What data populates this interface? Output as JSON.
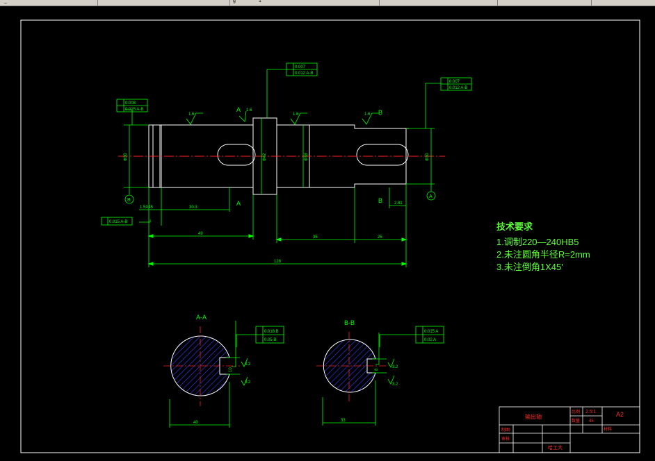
{
  "window": {
    "title_fragment": "_",
    "toolbar_fragment_1": "g",
    "toolbar_fragment_2": "1"
  },
  "colors": {
    "background": "#000000",
    "outline": "#ffffff",
    "dimension": "#00ff00",
    "centerline": "#ff0000",
    "hatch": "#3a3aff",
    "text": "#5dff3a",
    "titleblock_text": "#ff3030"
  },
  "roughness": {
    "r1": "1.6",
    "r2": "1.6",
    "r3": "1.6",
    "r4": "1.6",
    "r5": "1.6",
    "s1": "3.2",
    "s2": "3.2",
    "s3": "3.2",
    "s4": "3.2"
  },
  "datums": {
    "a": "A",
    "b": "B"
  },
  "tolerance_frames": {
    "left": {
      "row1": "0.008",
      "row2": "0.015 A-B"
    },
    "top_center": {
      "row1": "0.007",
      "row2": "0.012 A-B"
    },
    "top_right": {
      "row1": "0.007",
      "row2": "0.012 A-B"
    },
    "bottom_left": {
      "row1": "0.015 A-B"
    },
    "sec_aa": {
      "row1": "0.018 B",
      "row2": "0.05 B"
    },
    "sec_bb": {
      "row1": "0.015 A",
      "row2": "0.02 A"
    }
  },
  "dimensions": {
    "d_left": "1.5X45",
    "d_left2": "30.3",
    "d_49": "49",
    "d_35": "35",
    "d_25": "25",
    "d_total": "128",
    "d_right_small": "2.81",
    "dia_left": "Φ30",
    "dia_mid": "Φ42",
    "dia_mid2": "Φ38",
    "dia_right": "Φ30",
    "aa_width": "40",
    "bb_width": "33",
    "aa_key": "10",
    "bb_key": "8"
  },
  "sections": {
    "aa_label": "A-A",
    "bb_label": "B-B"
  },
  "tech_requirements": {
    "title": "技术要求",
    "line1": "1.调制220—240HB5",
    "line2": "2.未注圆角半径R=2mm",
    "line3": "3.未注倒角1X45'"
  },
  "title_block": {
    "part_name": "输出轴",
    "scale_label": "比例",
    "scale": "2.5:1",
    "qty_label": "数量",
    "qty": "45",
    "sheet": "A2",
    "material_label": "材料",
    "drawn": "制图",
    "checked": "审核",
    "school": "哈工大"
  }
}
